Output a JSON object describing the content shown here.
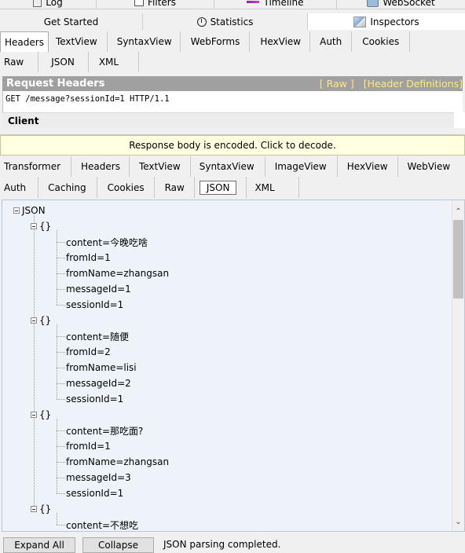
{
  "top_tabs_row1": [
    {
      "label": "Log",
      "icon": "log-icon"
    },
    {
      "label": "Filters",
      "icon": "filter-icon"
    },
    {
      "label": "Timeline",
      "icon": "timeline-icon"
    },
    {
      "label": "WebSocket",
      "icon": "websocket-icon"
    }
  ],
  "top_tabs_row2": [
    {
      "label": "Get Started"
    },
    {
      "label": "Statistics",
      "icon": "clock-icon"
    },
    {
      "label": "Inspectors",
      "icon": "inspectors-icon",
      "active": true
    }
  ],
  "request_tabs_row1": [
    "Headers",
    "TextView",
    "SyntaxView",
    "WebForms",
    "HexView",
    "Auth",
    "Cookies"
  ],
  "request_tabs_row2": [
    "Raw",
    "JSON",
    "XML"
  ],
  "request_headers": {
    "title": "Request Headers",
    "raw_link": "[ Raw ]",
    "definitions_link": "[Header Definitions]",
    "request_line": "GET /message?sessionId=1 HTTP/1.1",
    "group": "Client"
  },
  "notice": "Response body is encoded. Click to decode.",
  "response_tabs_row1": [
    "Transformer",
    "Headers",
    "TextView",
    "SyntaxView",
    "ImageView",
    "HexView",
    "WebView"
  ],
  "response_tabs_row2": [
    "Auth",
    "Caching",
    "Cookies",
    "Raw",
    "JSON",
    "XML"
  ],
  "json_tree": {
    "root": "JSON",
    "object_label": "{}",
    "objects": [
      [
        "content=今晚吃啥",
        "fromId=1",
        "fromName=zhangsan",
        "messageId=1",
        "sessionId=1"
      ],
      [
        "content=随便",
        "fromId=2",
        "fromName=lisi",
        "messageId=2",
        "sessionId=1"
      ],
      [
        "content=那吃面?",
        "fromId=1",
        "fromName=zhangsan",
        "messageId=3",
        "sessionId=1"
      ],
      [
        "content=不想吃"
      ]
    ]
  },
  "bottom_bar": {
    "expand_all": "Expand All",
    "collapse": "Collapse",
    "status": "JSON parsing completed."
  },
  "colors": {
    "header_bar": "#a0a0a0",
    "header_links": "#ffe97a",
    "notice_bg": "#ffffe1",
    "tree_bg": "#eef3fa"
  }
}
